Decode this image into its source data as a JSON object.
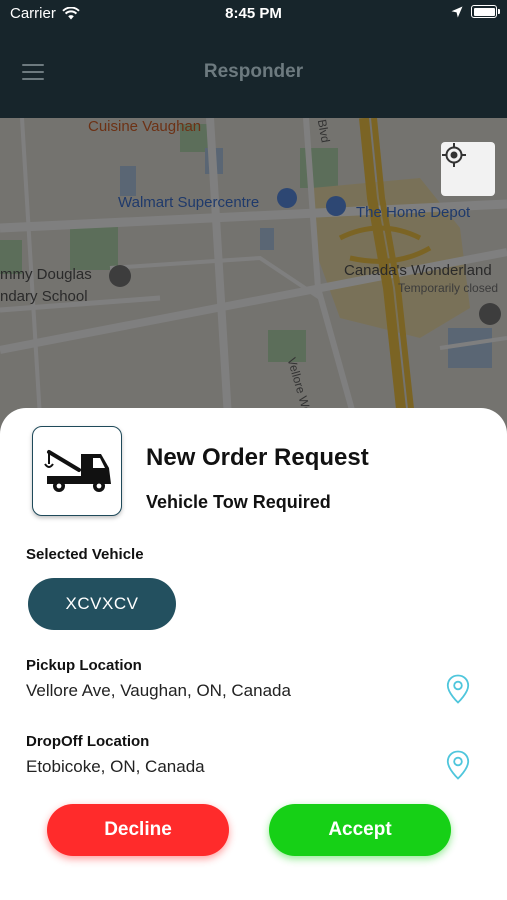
{
  "status_bar": {
    "carrier": "Carrier",
    "time": "8:45 PM"
  },
  "header": {
    "title": "Responder",
    "menu_icon": "menu-icon"
  },
  "map": {
    "labels": {
      "cuisine_vaughan": "Cuisine Vaughan",
      "walmart": "Walmart Supercentre",
      "home_depot": "The Home Depot",
      "tommy_douglas": "mmy Douglas",
      "secondary_school": "ndary School",
      "canadas_wonderland": "Canada's Wonderland",
      "temporarily_closed": "Temporarily closed",
      "blvd": "Blvd",
      "vellore_woods": "Vellore Woods Blvd"
    },
    "locate_icon": "crosshair-icon"
  },
  "order": {
    "title": "New Order Request",
    "subtitle": "Vehicle Tow Required",
    "icon": "tow-truck-icon",
    "selected_vehicle_label": "Selected Vehicle",
    "selected_vehicle_value": "XCVXCV",
    "pickup_label": "Pickup Location",
    "pickup_value": "Vellore Ave, Vaughan, ON, Canada",
    "dropoff_label": "DropOff Location",
    "dropoff_value": "Etobicoke, ON, Canada",
    "decline_label": "Decline",
    "accept_label": "Accept"
  },
  "colors": {
    "header_bg": "#17252b",
    "vehicle_pill": "#23505f",
    "decline": "#ff2b2b",
    "accept": "#16d016",
    "pin": "#4fc6dc"
  }
}
